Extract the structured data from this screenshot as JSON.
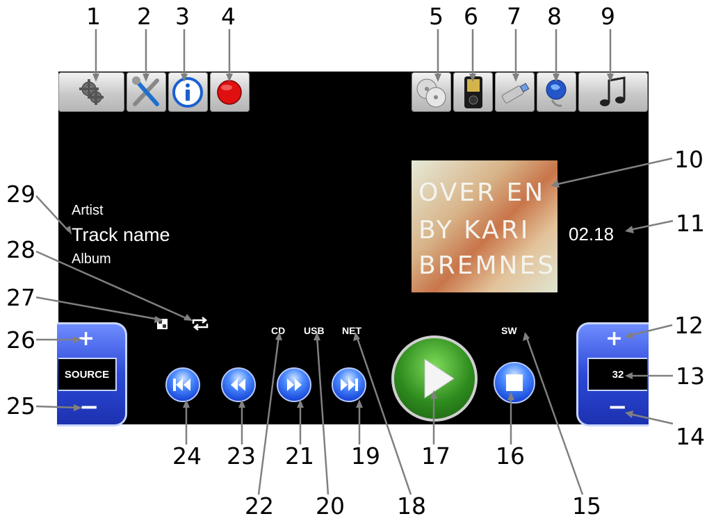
{
  "callouts": [
    "1",
    "2",
    "3",
    "4",
    "5",
    "6",
    "7",
    "8",
    "9",
    "10",
    "11",
    "12",
    "13",
    "14",
    "15",
    "16",
    "17",
    "18",
    "19",
    "20",
    "21",
    "22",
    "23",
    "24",
    "25",
    "26",
    "27",
    "28",
    "29"
  ],
  "toolbar_left": [
    {
      "name": "settings-gears-icon"
    },
    {
      "name": "tools-wrench-icon"
    },
    {
      "name": "info-icon"
    },
    {
      "name": "record-icon"
    }
  ],
  "toolbar_right": [
    {
      "name": "cd-discs-icon"
    },
    {
      "name": "media-player-device-icon"
    },
    {
      "name": "usb-stick-icon"
    },
    {
      "name": "network-globe-icon"
    },
    {
      "name": "music-note-icon"
    }
  ],
  "track": {
    "artist": "Artist",
    "name": "Track name",
    "album": "Album",
    "time": "02.18"
  },
  "album_art": {
    "line1": "OVER EN",
    "line2": "BY KARI",
    "line3": "BREMNES"
  },
  "sources": {
    "cd": "CD",
    "usb": "USB",
    "net": "NET",
    "sw": "SW"
  },
  "source_control": {
    "plus": "+",
    "label": "SOURCE",
    "minus": "−"
  },
  "volume_control": {
    "plus": "+",
    "value": "32",
    "minus": "−"
  },
  "colors": {
    "accent_blue": "#2c49d8",
    "play_green": "#2e8b1e",
    "record_red": "#e01010"
  }
}
